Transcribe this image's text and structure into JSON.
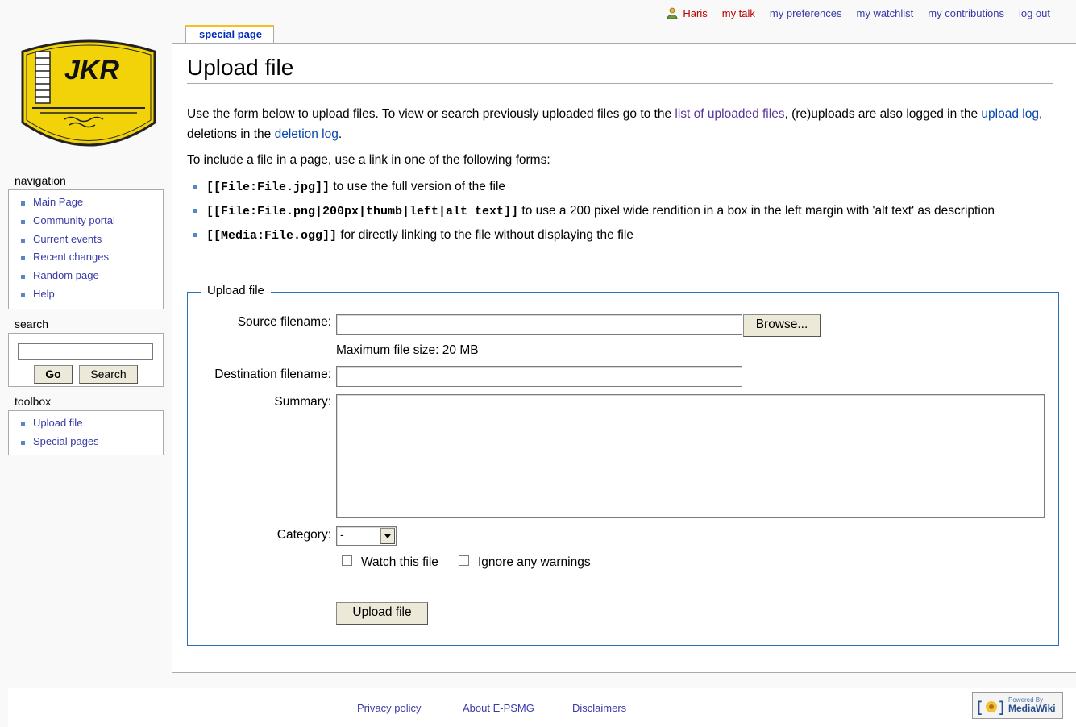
{
  "personal": {
    "username": "Haris",
    "my_talk": "my talk",
    "my_preferences": "my preferences",
    "my_watchlist": "my watchlist",
    "my_contributions": "my contributions",
    "log_out": "log out"
  },
  "tabs": {
    "special_page": "special page"
  },
  "logo": {
    "text": "JKR"
  },
  "page": {
    "title": "Upload file",
    "intro_1": "Use the form below to upload files. To view or search previously uploaded files go to the ",
    "intro_link_1": "list of uploaded files",
    "intro_2": ", (re)uploads are also logged in the ",
    "intro_link_2": "upload log",
    "intro_3": ", deletions in the ",
    "intro_link_3": "deletion log",
    "intro_4": ".",
    "include_text": "To include a file in a page, use a link in one of the following forms:",
    "forms": [
      {
        "code": "[[File:File.jpg]]",
        "text": " to use the full version of the file"
      },
      {
        "code": "[[File:File.png|200px|thumb|left|alt text]]",
        "text": " to use a 200 pixel wide rendition in a box in the left margin with 'alt text' as description"
      },
      {
        "code": "[[Media:File.ogg]]",
        "text": " for directly linking to the file without displaying the file"
      }
    ]
  },
  "form": {
    "legend": "Upload file",
    "source_label": "Source filename:",
    "browse_label": "Browse...",
    "max_size": "Maximum file size: 20 MB",
    "dest_label": "Destination filename:",
    "summary_label": "Summary:",
    "category_label": "Category:",
    "category_value": "-",
    "watch_label": "Watch this file",
    "ignore_label": "Ignore any warnings",
    "submit_label": "Upload file"
  },
  "sidebar": {
    "navigation_title": "navigation",
    "navigation": [
      "Main Page",
      "Community portal",
      "Current events",
      "Recent changes",
      "Random page",
      "Help"
    ],
    "search_title": "search",
    "go_label": "Go",
    "search_label": "Search",
    "toolbox_title": "toolbox",
    "toolbox": [
      "Upload file",
      "Special pages"
    ]
  },
  "footer": {
    "privacy": "Privacy policy",
    "about": "About E-PSMG",
    "disclaimers": "Disclaimers",
    "powered_by_small": "Powered By",
    "powered_by_big": "MediaWiki"
  }
}
